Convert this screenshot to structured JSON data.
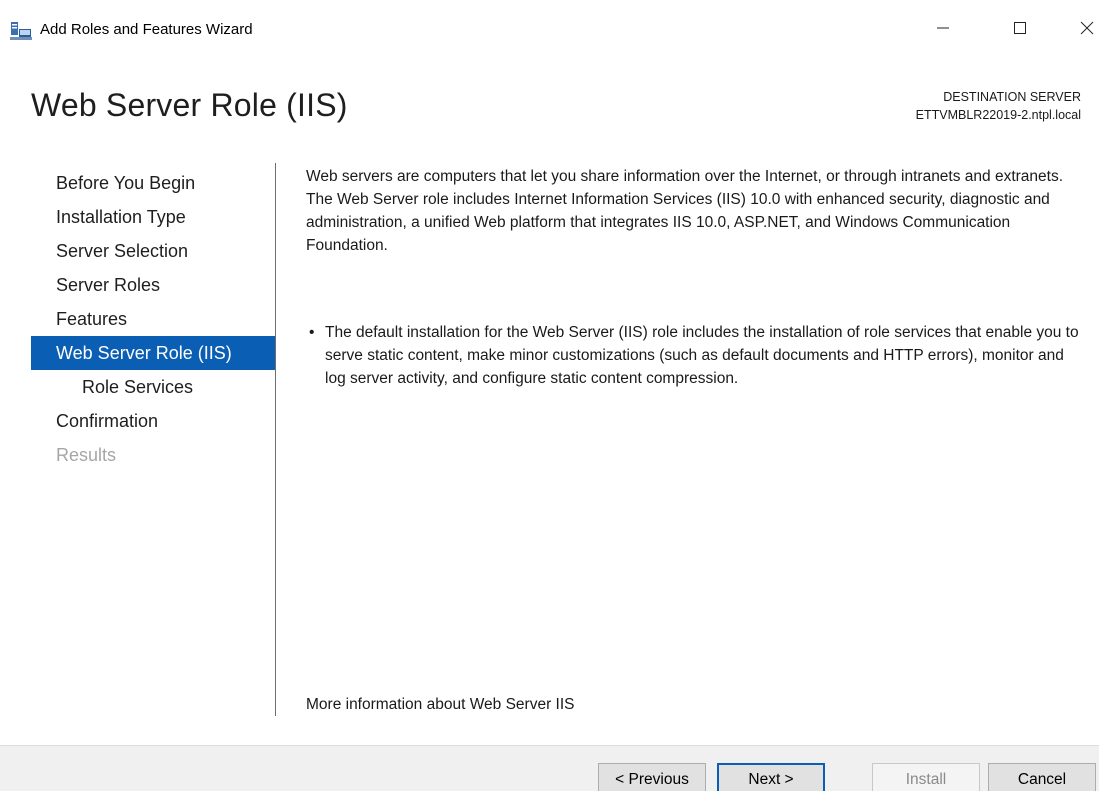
{
  "window": {
    "title": "Add Roles and Features Wizard",
    "icons": [
      "server-manager-app-icon",
      "minimize-icon",
      "maximize-icon",
      "close-icon"
    ]
  },
  "header": {
    "page_title": "Web Server Role (IIS)",
    "destination_label": "DESTINATION SERVER",
    "destination_server": "ETTVMBLR22019-2.ntpl.local"
  },
  "sidebar": {
    "items": [
      {
        "label": "Before You Begin",
        "state": "normal"
      },
      {
        "label": "Installation Type",
        "state": "normal"
      },
      {
        "label": "Server Selection",
        "state": "normal"
      },
      {
        "label": "Server Roles",
        "state": "normal"
      },
      {
        "label": "Features",
        "state": "normal"
      },
      {
        "label": "Web Server Role (IIS)",
        "state": "active"
      },
      {
        "label": "Role Services",
        "state": "sub"
      },
      {
        "label": "Confirmation",
        "state": "normal"
      },
      {
        "label": "Results",
        "state": "disabled"
      }
    ]
  },
  "main": {
    "intro": "Web servers are computers that let you share information over the Internet, or through intranets and extranets. The Web Server role includes Internet Information Services (IIS) 10.0 with enhanced security, diagnostic and administration, a unified Web platform that integrates IIS 10.0, ASP.NET, and Windows Communication Foundation.",
    "bullets": [
      "The default installation for the Web Server (IIS) role includes the installation of role services that enable you to serve static content, make minor customizations (such as default documents and HTTP errors), monitor and log server activity, and configure static content compression."
    ],
    "more_info_link": "More information about Web Server IIS"
  },
  "footer": {
    "previous_label": "< Previous",
    "next_label": "Next >",
    "install_label": "Install",
    "cancel_label": "Cancel"
  },
  "colors": {
    "accent": "#0a5fb5",
    "active_text": "#ffffff",
    "disabled_text": "#a6a6a6",
    "footer_bg": "#f0f0f0"
  }
}
